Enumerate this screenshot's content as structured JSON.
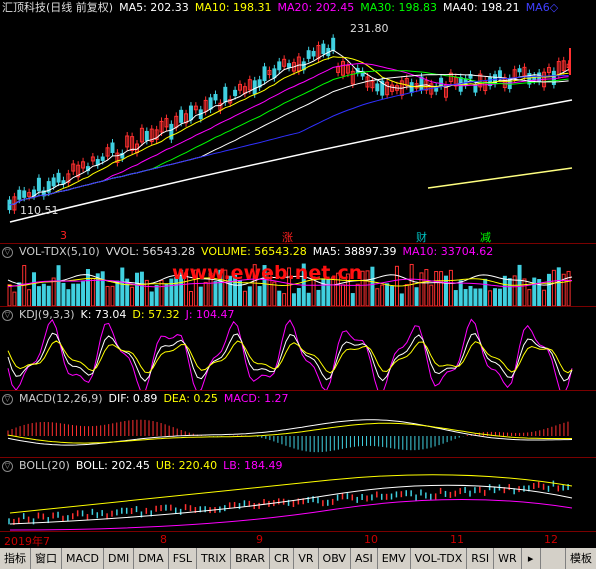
{
  "main": {
    "title": "汇顶科技(日线 前复权)",
    "ma": [
      {
        "label": "MA5: 202.33",
        "color": "#ffffff"
      },
      {
        "label": "MA10: 198.31",
        "color": "#ffff00"
      },
      {
        "label": "MA20: 202.45",
        "color": "#ff00ff"
      },
      {
        "label": "MA30: 198.83",
        "color": "#00ff00"
      },
      {
        "label": "MA40: 198.21",
        "color": "#ffffff"
      },
      {
        "label": "MA6◇",
        "color": "#4040ff"
      }
    ],
    "high_label": "231.80",
    "low_label": "110.51",
    "markers": [
      {
        "text": "3",
        "color": "#ff2020"
      },
      {
        "text": "涨",
        "color": "#ff2020"
      },
      {
        "text": "财",
        "color": "#00c0c0"
      },
      {
        "text": "减",
        "color": "#00ff00"
      }
    ]
  },
  "volume": {
    "name": "VOL-TDX(5,10)",
    "vvol": "VVOL: 56543.28",
    "volume": "VOLUME: 56543.28",
    "ma5": "MA5: 38897.39",
    "ma10": "MA10: 33704.62",
    "watermark": "www.eweb.net.cn"
  },
  "kdj": {
    "name": "KDJ(9,3,3)",
    "k": "K: 73.04",
    "d": "D: 57.32",
    "j": "J: 104.47"
  },
  "macd": {
    "name": "MACD(12,26,9)",
    "dif": "DIF: 0.89",
    "dea": "DEA: 0.25",
    "macd": "MACD: 1.27"
  },
  "boll": {
    "name": "BOLL(20)",
    "boll": "BOLL: 202.45",
    "ub": "UB: 220.40",
    "lb": "LB: 184.49"
  },
  "xaxis": [
    "2019年7",
    "8",
    "9",
    "10",
    "11",
    "12"
  ],
  "tabs": [
    "指标",
    "窗口",
    "MACD",
    "DMI",
    "DMA",
    "FSL",
    "TRIX",
    "BRAR",
    "CR",
    "VR",
    "OBV",
    "ASI",
    "EMV",
    "VOL-TDX",
    "RSI",
    "WR"
  ],
  "tab_last": "模板",
  "tab_arrow": "▸",
  "colors": {
    "up": "#ff3030",
    "down": "#40d0e0",
    "frame": "#7a0000"
  }
}
